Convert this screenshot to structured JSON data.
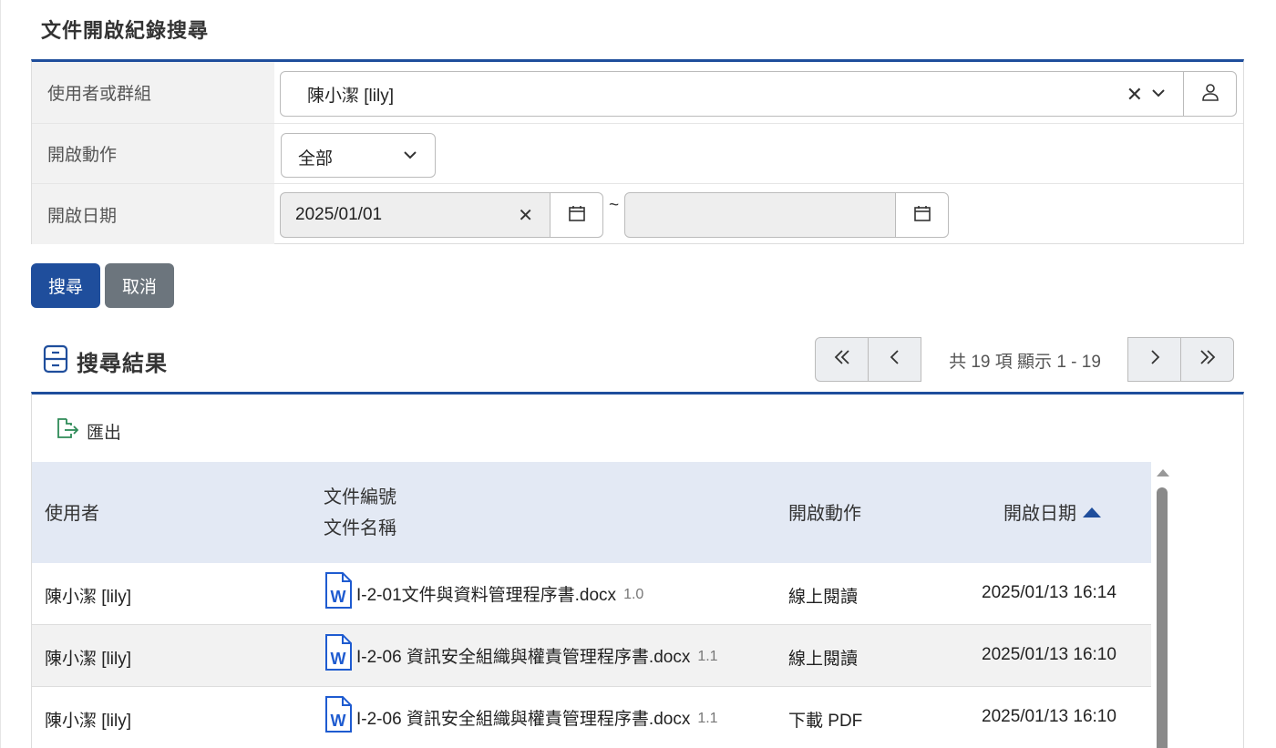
{
  "page": {
    "title": "文件開啟紀錄搜尋"
  },
  "form": {
    "user_label": "使用者或群組",
    "user_value": "陳小潔 [lily]",
    "action_label": "開啟動作",
    "action_value": "全部",
    "date_label": "開啟日期",
    "date_from": "2025/01/01",
    "date_to": "",
    "tilde": "~"
  },
  "buttons": {
    "search": "搜尋",
    "cancel": "取消"
  },
  "results": {
    "title": "搜尋結果",
    "export_label": "匯出",
    "pager_info": "共 19 項 顯示 1 - 19",
    "columns": {
      "user": "使用者",
      "doc_number": "文件編號",
      "doc_name": "文件名稱",
      "action": "開啟動作",
      "date": "開啟日期"
    },
    "rows": [
      {
        "user": "陳小潔 [lily]",
        "doc": "I-2-01文件與資料管理程序書.docx",
        "version": "1.0",
        "action": "線上閱讀",
        "date": "2025/01/13 16:14"
      },
      {
        "user": "陳小潔 [lily]",
        "doc": "I-2-06 資訊安全組織與權責管理程序書.docx",
        "version": "1.1",
        "action": "線上閱讀",
        "date": "2025/01/13 16:10"
      },
      {
        "user": "陳小潔 [lily]",
        "doc": "I-2-06 資訊安全組織與權責管理程序書.docx",
        "version": "1.1",
        "action": "下載 PDF",
        "date": "2025/01/13 16:10"
      }
    ]
  },
  "icons": {
    "clear": "close-icon",
    "dropdown": "chevron-down-icon",
    "user_picker": "user-icon",
    "calendar": "calendar-icon",
    "export": "export-icon",
    "results": "cabinet-icon",
    "word_file": "word-file-icon"
  },
  "colors": {
    "primary": "#1f4e9c",
    "secondary": "#6c757d",
    "header_bg": "#e3e9f4"
  }
}
